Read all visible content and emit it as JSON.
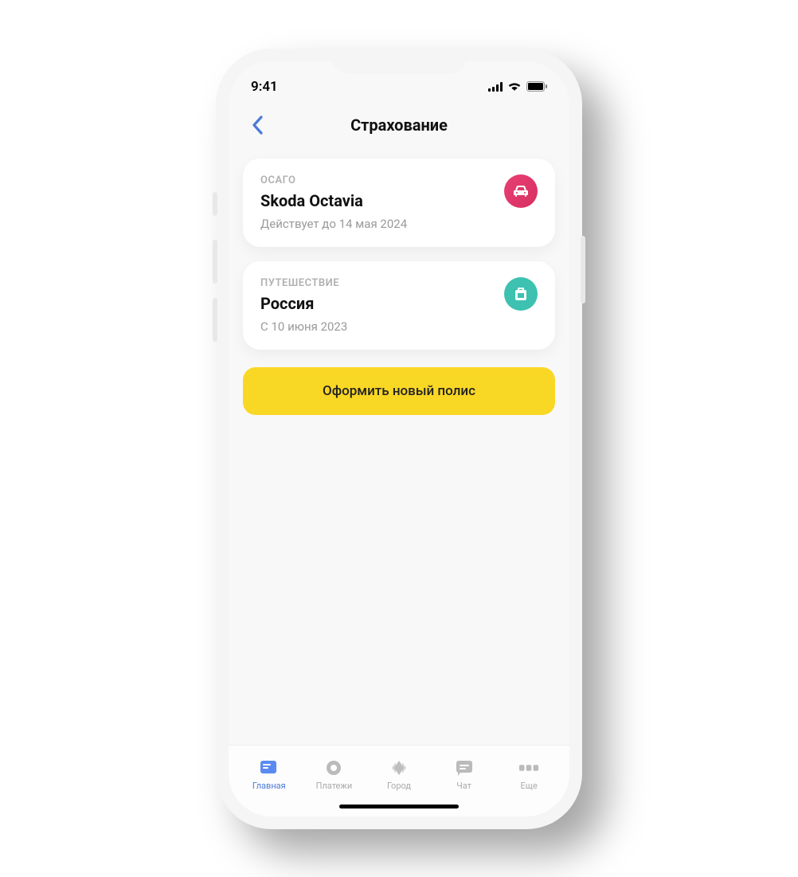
{
  "status": {
    "time": "9:41"
  },
  "header": {
    "title": "Страхование"
  },
  "policies": [
    {
      "category": "ОСАГО",
      "title": "Skoda Octavia",
      "sub": "Действует до 14 мая 2024",
      "icon": "car",
      "color": "pink"
    },
    {
      "category": "ПУТЕШЕСТВИЕ",
      "title": "Россия",
      "sub": "С 10 июня 2023",
      "icon": "travel",
      "color": "teal"
    }
  ],
  "cta": {
    "label": "Оформить новый полис"
  },
  "tabs": [
    {
      "label": "Главная",
      "icon": "home",
      "active": true
    },
    {
      "label": "Платежи",
      "icon": "payments",
      "active": false
    },
    {
      "label": "Город",
      "icon": "city",
      "active": false
    },
    {
      "label": "Чат",
      "icon": "chat",
      "active": false
    },
    {
      "label": "Еще",
      "icon": "more",
      "active": false
    }
  ],
  "colors": {
    "accent_blue": "#4a7ad8",
    "cta_yellow": "#f9d725",
    "icon_pink": "#e94074",
    "icon_teal": "#3dc1b0"
  }
}
